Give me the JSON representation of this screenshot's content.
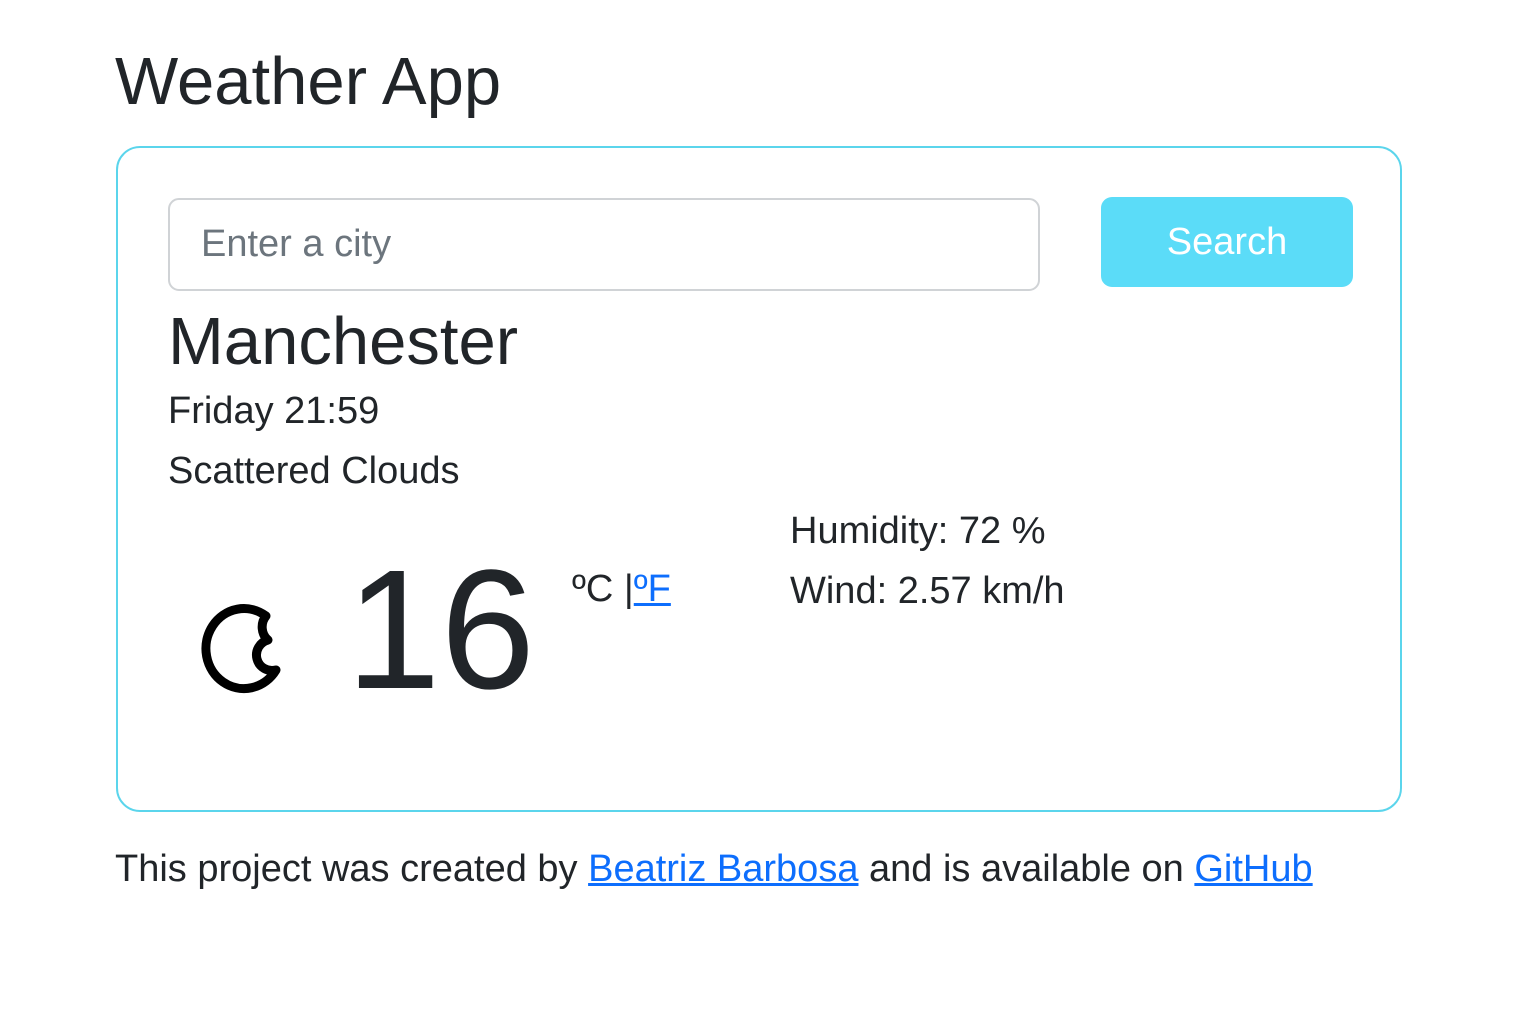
{
  "app": {
    "title": "Weather App"
  },
  "search": {
    "placeholder": "Enter a city",
    "value": "",
    "button_label": "Search"
  },
  "weather": {
    "city": "Manchester",
    "date_time": "Friday 21:59",
    "description": "Scattered Clouds",
    "icon": "moon-icon",
    "temperature": "16",
    "unit_celsius": "ºC",
    "unit_separator": " |",
    "unit_fahrenheit": "ºF",
    "humidity": "Humidity: 72 %",
    "wind": "Wind: 2.57 km/h"
  },
  "footer": {
    "text_before": "This project was created by ",
    "author_link": "Beatriz Barbosa",
    "text_middle": " and is available on ",
    "github_link": "GitHub"
  },
  "colors": {
    "card_border": "#5bd5ec",
    "button_bg": "#5bdcf8",
    "link": "#0d6efd",
    "text": "#212529"
  }
}
